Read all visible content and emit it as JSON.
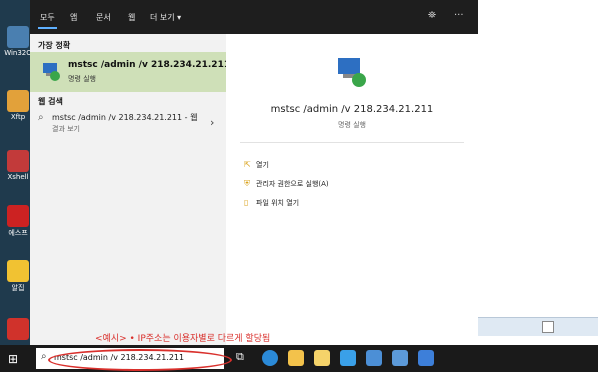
{
  "desktop": {
    "icons": [
      {
        "label": "Win32O",
        "color": "#4a7fb0"
      },
      {
        "label": "Xftp",
        "color": "#e2a13a"
      },
      {
        "label": "Xshell",
        "color": "#c23a3a"
      },
      {
        "label": "에스프",
        "color": "#cc2222"
      },
      {
        "label": "알집",
        "color": "#f1c232"
      }
    ]
  },
  "panel": {
    "tabs": [
      "모두",
      "앱",
      "문서",
      "웹",
      "더 보기 ▾"
    ],
    "tab_right_icons": [
      "person-feedback-icon",
      "more-icon"
    ],
    "best_match_heading": "가장 정확",
    "best_match": {
      "title": "mstsc /admin /v 218.234.21.211",
      "subtitle": "명령 실행"
    },
    "web_heading": "웹 검색",
    "web_item": {
      "title": "mstsc /admin /v 218.234.21.211 - 웹",
      "subtitle": "결과 보기"
    },
    "preview": {
      "title": "mstsc /admin /v 218.234.21.211",
      "subtitle": "명령 실행"
    },
    "actions": [
      {
        "label": "열기",
        "icon": "open-icon"
      },
      {
        "label": "관리자 권한으로 실행(A)",
        "icon": "shield-icon"
      },
      {
        "label": "파일 위치 열기",
        "icon": "file-location-icon"
      }
    ]
  },
  "caption": "<예시> • IP주소는 이용자별로 다르게 할당됨",
  "taskbar": {
    "search_value": "mstsc /admin /v 218.234.21.211",
    "pinned": [
      {
        "name": "task-view-icon",
        "color": "#ffffff"
      },
      {
        "name": "edge-icon",
        "color": "#2b8ad8"
      },
      {
        "name": "file-explorer-icon",
        "color": "#f3c24b"
      },
      {
        "name": "store-icon",
        "color": "#f5d36a"
      },
      {
        "name": "mail-icon",
        "color": "#3aa0e8"
      },
      {
        "name": "remote-desktop-icon",
        "color": "#4c8fd6"
      },
      {
        "name": "notes-icon",
        "color": "#5c9ad9"
      },
      {
        "name": "calendar-icon",
        "color": "#3d7fd9"
      }
    ]
  }
}
